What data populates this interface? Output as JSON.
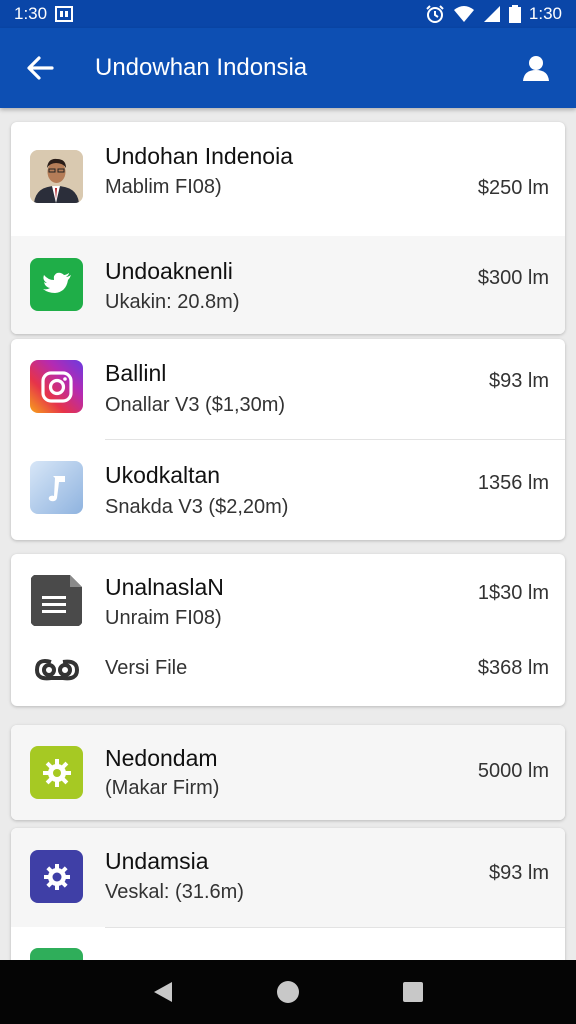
{
  "status_bar": {
    "time_left": "1:30",
    "time_right": "1:30",
    "icons_left": [
      "image-icon"
    ],
    "icons_right": [
      "alarm-icon",
      "wifi-icon",
      "signal-icon",
      "battery-icon"
    ]
  },
  "app_bar": {
    "title": "Undowhan Indonsia",
    "back_icon": "arrow-back-icon",
    "profile_icon": "person-icon",
    "color": "#0d4fb3"
  },
  "cards": [
    {
      "rows": [
        {
          "icon": "portrait",
          "title": "Undohan Indenoia",
          "subtitle": "Mablim FI08)",
          "price": "$250 lm"
        },
        {
          "icon": "twitter",
          "title": "Undoaknenli",
          "subtitle": "Ukakin: 20.8m)",
          "price": "$300 lm"
        }
      ]
    },
    {
      "rows": [
        {
          "icon": "instagram",
          "title": "Ballinl",
          "subtitle": "Onallar V3 ($1,30m)",
          "price": "$93 lm"
        },
        {
          "icon": "music",
          "title": "Ukodkaltan",
          "subtitle": "Snakda V3 ($2,20m)",
          "price": "1356 lm"
        }
      ]
    },
    {
      "rows": [
        {
          "icon": "document",
          "title": "UnalnaslaN",
          "subtitle": "Unraim FI08)",
          "price": "1$30 lm"
        },
        {
          "icon": "link",
          "title": "",
          "subtitle": "Versi File",
          "price": "$368 lm"
        }
      ]
    },
    {
      "rows": [
        {
          "icon": "gear-green",
          "title": "Nedondam",
          "subtitle": "(Makar Firm)",
          "price": "5000 lm"
        }
      ]
    },
    {
      "rows": [
        {
          "icon": "gear-indigo",
          "title": "Undamsia",
          "subtitle": "Veskal: (31.6m)",
          "price": "$93 lm"
        },
        {
          "icon": "green-partial",
          "title": "",
          "subtitle": "",
          "price": ""
        }
      ]
    }
  ],
  "nav_bar": {
    "back_icon": "nav-back-icon",
    "home_icon": "nav-home-icon",
    "recents_icon": "nav-recents-icon"
  }
}
